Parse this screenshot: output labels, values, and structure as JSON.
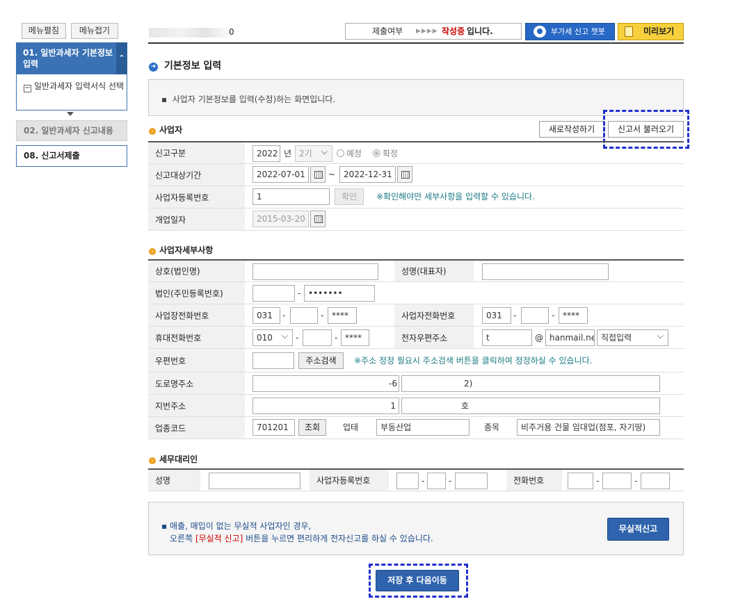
{
  "sidebar": {
    "expand_label": "메뉴펼침",
    "collapse_label": "메뉴접기",
    "steps": [
      {
        "label": "01. 일반과세자 기본정보 입력",
        "state": "active"
      },
      {
        "label": "02. 일반과세자 신고내용",
        "state": "disabled"
      },
      {
        "label": "08. 신고서제출",
        "state": "normal"
      }
    ],
    "sub_item": "일반과세자 입력서식 선택"
  },
  "header": {
    "masked_suffix": "0",
    "status_label": "제출여부",
    "status_arrows": "▶▶▶▶",
    "status_value": "작성중",
    "status_tail": "입니다.",
    "chatbot_label": "부가세 신고 챗봇",
    "preview_label": "미리보기"
  },
  "page": {
    "title": "기본정보 입력",
    "info_text": "사업자 기본정보를 입력(수정)하는 화면입니다."
  },
  "business": {
    "heading": "사업자",
    "new_button": "새로작성하기",
    "load_button": "신고서 불러오기",
    "report_type_label": "신고구분",
    "year": "2022",
    "year_unit": "년",
    "period": "2기",
    "radio_scheduled": "예정",
    "radio_final": "확정",
    "period_label": "신고대상기간",
    "period_from": "2022-07-01",
    "period_tilde": "~",
    "period_to": "2022-12-31",
    "regno_label": "사업자등록번호",
    "regno_prefix": "1",
    "confirm_button": "확인",
    "regno_note": "※확인해야만 세부사항을 입력할 수 있습니다.",
    "open_date_label": "개업일자",
    "open_date": "2015-03-20"
  },
  "details": {
    "heading": "사업자세부사항",
    "trade_name_label": "상호(법인명)",
    "rep_name_label": "성명(대표자)",
    "corp_no_label": "법인(주민등록번호)",
    "corp_no_tail": "•••••••",
    "site_phone_label": "사업장전화번호",
    "site_phone_1": "031",
    "site_phone_3": "****",
    "biz_phone_label": "사업자전화번호",
    "biz_phone_1": "031",
    "biz_phone_3": "****",
    "mobile_label": "휴대전화번호",
    "mobile_1": "010",
    "mobile_3": "****",
    "email_label": "전자우편주소",
    "email_user_prefix": "t",
    "email_at": "@",
    "email_domain": "hanmail.ne",
    "email_select": "직접입력",
    "zip_label": "우편번호",
    "address_search_button": "주소검색",
    "zip_note": "※주소 정정 필요시 주소검색 버튼을 클릭하여 정정하실 수 있습니다.",
    "road_addr_label": "도로명주소",
    "road_addr_mid": "-6",
    "road_addr_tail": "2)",
    "lot_addr_label": "지번주소",
    "lot_addr_mid": "1",
    "lot_addr_tail": "호",
    "industry_code_label": "업종코드",
    "industry_code": "701201",
    "lookup_button": "조회",
    "biz_type_label": "업태",
    "biz_type": "부동산업",
    "biz_item_label": "종목",
    "biz_item": "비주거용 건물 임대업(점포, 자기땅)"
  },
  "agent": {
    "heading": "세무대리인",
    "name_label": "성명",
    "regno_label": "사업자등록번호",
    "phone_label": "전화번호"
  },
  "zero_report": {
    "line1": "매출, 매입이 없는 무실적 사업자인 경우,",
    "line2_before": "오른쪽 ",
    "line2_highlight": "[무실적 신고]",
    "line2_after": " 버튼을 누르면 편리하게 전자신고를 하실 수 있습니다.",
    "button": "무실적신고"
  },
  "footer": {
    "save_next_button": "저장 후 다음이동"
  },
  "colors": {
    "primary": "#3a72b5",
    "status_red": "#cc0000",
    "preview_yellow": "#f8d03c",
    "highlight_dash": "#1f2fcf",
    "note_teal": "#1a7a85"
  }
}
